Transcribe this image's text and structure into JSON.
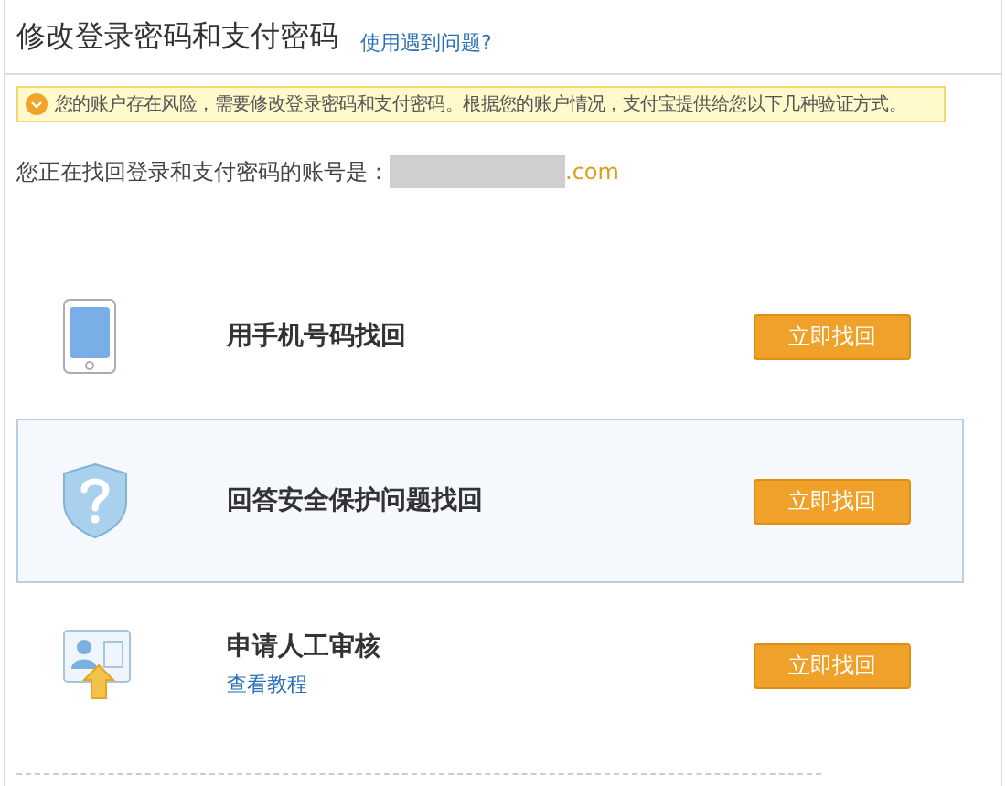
{
  "header": {
    "title": "修改登录密码和支付密码",
    "help_link": "使用遇到问题?"
  },
  "notice": {
    "text": "您的账户存在风险，需要修改登录密码和支付密码。根据您的账户情况，支付宝提供给您以下几种验证方式。"
  },
  "account": {
    "label": "您正在找回登录和支付密码的账号是：",
    "suffix": ".com"
  },
  "options": [
    {
      "kind": "phone",
      "title": "用手机号码找回",
      "button": "立即找回",
      "selected": false
    },
    {
      "kind": "question",
      "title": "回答安全保护问题找回",
      "button": "立即找回",
      "selected": true
    },
    {
      "kind": "manual",
      "title": "申请人工审核",
      "link": "查看教程",
      "button": "立即找回",
      "selected": false
    }
  ]
}
